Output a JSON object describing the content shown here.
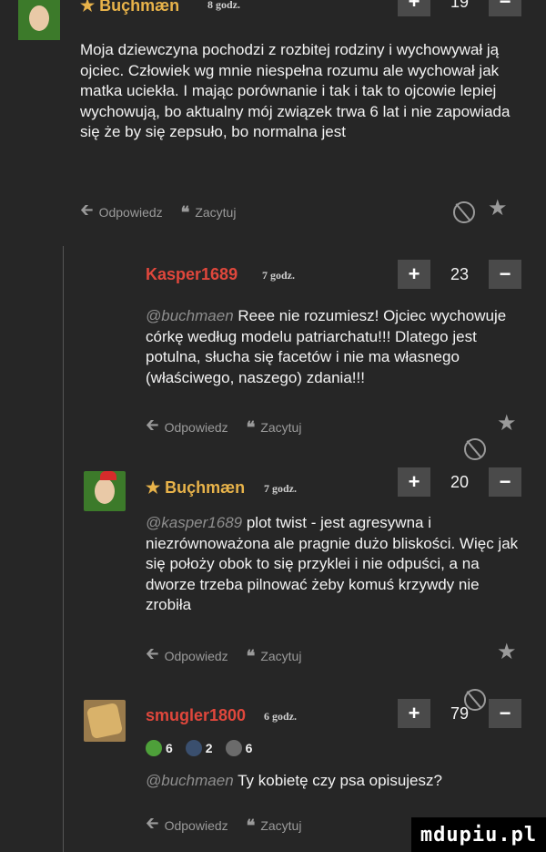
{
  "top": {
    "nick": "★ Buçhmæn",
    "time": "8 godz.",
    "count": "19"
  },
  "comments": [
    {
      "body": "Moja dziewczyna pochodzi z rozbitej rodziny i wychowywał ją ojciec. Człowiek wg mnie niespełna rozumu ale wychował jak matka uciekła. I mając porównanie i tak i tak to ojcowie lepiej wychowują, bo aktualny mój związek trwa 6 lat i nie zapowiada się że by się zepsuło, bo normalna jest",
      "reply": "Odpowiedz",
      "quote": "Zacytuj"
    },
    {
      "nick": "Kasper1689",
      "time": "7 godz.",
      "count": "23",
      "mention": "@buchmaen",
      "body": "Reee nie rozumiesz! Ojciec wychowuje córkę według modelu patriarchatu!!! Dlatego jest potulna, słucha się facetów i nie ma własnego (właściwego, naszego) zdania!!!",
      "reply": "Odpowiedz",
      "quote": "Zacytuj"
    },
    {
      "nick": "★ Buçhmæn",
      "time": "7 godz.",
      "count": "20",
      "mention": "@kasper1689",
      "body": "plot twist - jest agresywna i niezrównoważona ale pragnie dużo bliskości. Więc jak się położy obok to się przyklei i nie odpuści, a na dworze trzeba pilnować żeby komuś krzywdy nie zrobiła",
      "reply": "Odpowiedz",
      "quote": "Zacytuj"
    },
    {
      "nick": "smugler1800",
      "time": "6 godz.",
      "count": "79",
      "badges": [
        "6",
        "2",
        "6"
      ],
      "mention": "@buchmaen",
      "body": "Ty kobietę czy psa opisujesz?",
      "reply": "Odpowiedz",
      "quote": "Zacytuj"
    }
  ],
  "vote": {
    "plus": "+",
    "minus": "−"
  },
  "watermark": "mdupiu.pl"
}
